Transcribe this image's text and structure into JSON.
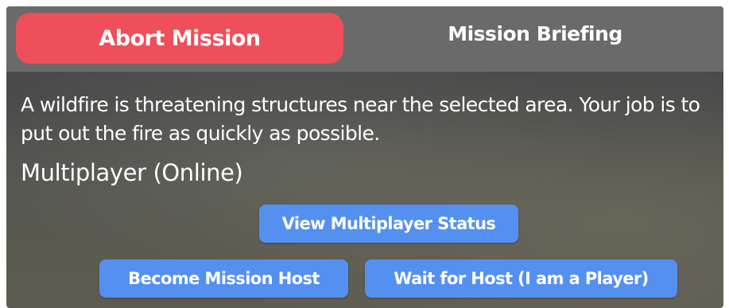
{
  "tabs": {
    "abort_label": "Abort Mission",
    "briefing_label": "Mission Briefing",
    "abort_color": "#ef4f5b"
  },
  "mission": {
    "description": "A wildfire is threatening structures near the selected area. Your job is to put out the fire as quickly as possible.",
    "mode_heading": "Multiplayer (Online)"
  },
  "buttons": {
    "view_status": "View Multiplayer Status",
    "become_host": "Become Mission Host",
    "wait_for_host": "Wait for Host (I am a Player)",
    "color": "#5490f0"
  }
}
